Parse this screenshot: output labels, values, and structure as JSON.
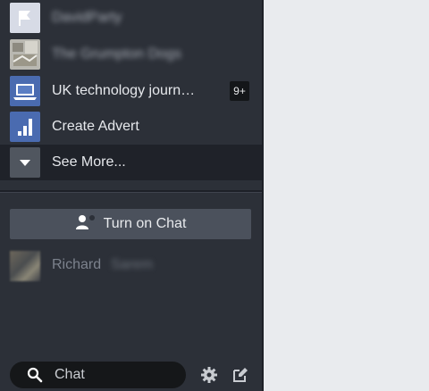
{
  "shortcuts": [
    {
      "label": "DavidParty",
      "icon": "flag-icon",
      "blurred": true
    },
    {
      "label": "The Grumpton Dogs",
      "icon": "page-thumbnail-icon",
      "blurred": true
    },
    {
      "label": "UK technology journ…",
      "icon": "laptop-icon",
      "blurred": false,
      "badge": "9+"
    },
    {
      "label": "Create Advert",
      "icon": "bar-chart-icon",
      "blurred": false
    }
  ],
  "see_more": {
    "label": "See More...",
    "icon": "chevron-down-icon"
  },
  "chat": {
    "button_label": "Turn on Chat",
    "button_icon": "person-status-icon"
  },
  "contacts": [
    {
      "first_name": "Richard",
      "last_name": "Sarem"
    }
  ],
  "search": {
    "placeholder": "Chat"
  },
  "toolbar": {
    "settings_icon": "gear-icon",
    "compose_icon": "compose-icon"
  },
  "colors": {
    "sidebar_bg": "#2c3038",
    "see_more_bg": "#1f2229",
    "chat_button_bg": "#4b515c",
    "search_bg": "#151719",
    "page_bg": "#e9ebee",
    "icon_blue": "#3b5998"
  }
}
